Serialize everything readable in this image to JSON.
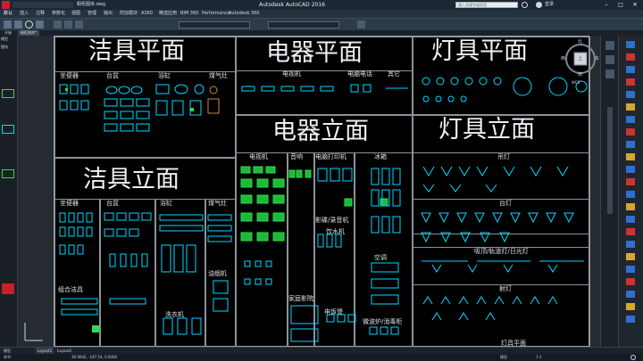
{
  "titlebar": {
    "app_title": "Autodesk AutoCAD 2016",
    "file_name": "橱柜图库.dwg",
    "search_placeholder": "键入关键字或短语",
    "login_label": "登录",
    "quick_label": "快速入门"
  },
  "ribbon": {
    "tabs": [
      "默认",
      "插入",
      "注释",
      "参数化",
      "视图",
      "管理",
      "输出",
      "附加模块",
      "A360",
      "精选应用",
      "BIM 360",
      "Performance",
      "Autodesk 360"
    ]
  },
  "doc_tabs": [
    "开始",
    "橱柜图库*"
  ],
  "left_panel": {
    "header": "模型",
    "items": [
      "图块"
    ]
  },
  "viewcube": {
    "north": "北",
    "south": "南",
    "east": "东",
    "west": "西",
    "top": "上",
    "wcs": "WCS"
  },
  "drawing": {
    "titles": {
      "sanitary_plan": "洁具平面",
      "electric_plan": "电器平面",
      "lamp_plan": "灯具平面",
      "electric_elev": "电器立面",
      "lamp_elev": "灯具立面",
      "sanitary_elev": "洁具立面"
    },
    "labels": {
      "toilet": "坐便器",
      "basin": "台盆",
      "bathtub": "浴缸",
      "heater": "煤气灶",
      "tv": "电视机",
      "phone": "电脑电话",
      "other": "其它",
      "toilet2": "坐便器",
      "basin2": "台盆",
      "bathtub2": "浴缸",
      "gas": "煤气灶",
      "hood": "油烟机",
      "combo": "组合洁具",
      "washer": "洗衣机",
      "tv2": "电视机",
      "audio": "音响",
      "pc_printer": "电脑打印机",
      "fridge": "冰箱",
      "video": "影碟/录音机",
      "water": "饮水机",
      "ac": "空调",
      "home_video": "家庭影院",
      "electric_box": "电饭煲",
      "microwave": "微波炉/消毒柜",
      "chandelier": "吊灯",
      "desk": "台灯",
      "ceiling": "吸顶/轨道灯/日光灯",
      "spot": "射灯",
      "lamp_plan_bottom": "灯具平面"
    }
  },
  "layout_tabs": [
    "模型",
    "Layout1",
    "Layout2"
  ],
  "statusbar": {
    "command": "命令:",
    "coords": "36.9042, -187.54, 0.0000",
    "mode": "模型",
    "scale": "1:1"
  },
  "colors": {
    "background": "#212830",
    "sheet": "#000000",
    "line": "#9aa1a8",
    "cyan": "#00d9ff",
    "green": "#27e048",
    "white": "#eef1f4"
  }
}
